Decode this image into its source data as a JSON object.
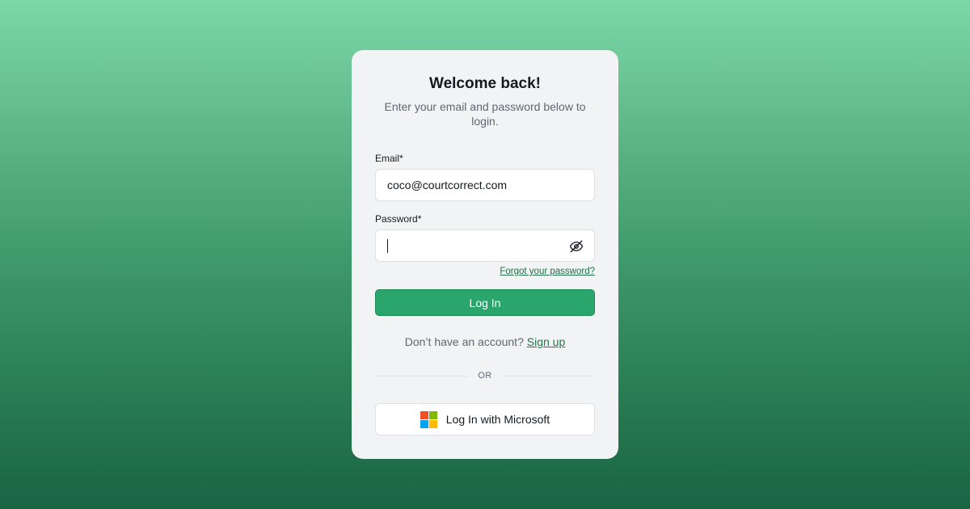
{
  "login": {
    "title": "Welcome back!",
    "subtitle": "Enter your email and password below to login.",
    "email_label": "Email*",
    "email_value": "coco@courtcorrect.com",
    "password_label": "Password*",
    "password_value": "",
    "forgot_link": "Forgot your password?",
    "login_button": "Log In",
    "signup_prompt": "Don’t have an account?",
    "signup_link": "Sign up",
    "divider_text": "OR",
    "microsoft_button": "Log In with Microsoft"
  },
  "icons": {
    "password_toggle": "eye-off-icon",
    "microsoft": "microsoft-logo"
  },
  "colors": {
    "primary": "#2aa56c",
    "link": "#1e7a4c",
    "ms_red": "#f25022",
    "ms_green": "#7fba00",
    "ms_blue": "#00a4ef",
    "ms_yellow": "#ffb900"
  }
}
